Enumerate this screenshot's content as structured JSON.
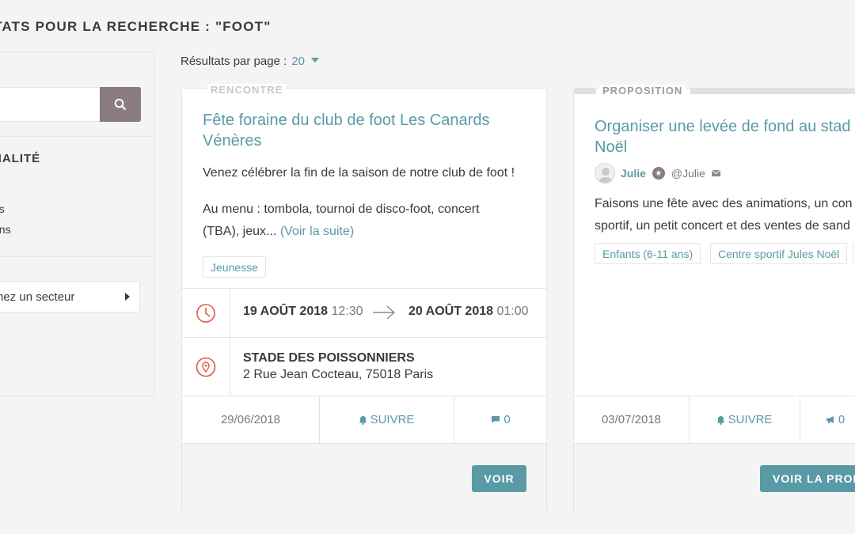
{
  "page": {
    "title": "TATS POUR LA RECHERCHE : \"FOOT\""
  },
  "sidebar": {
    "search": {
      "value": ""
    },
    "filter_title": "NALITÉ",
    "options": [
      "es",
      "ons"
    ],
    "sector_select": "nez un secteur"
  },
  "results": {
    "per_page_label": "Résultats par page :",
    "per_page_value": "20"
  },
  "cards": [
    {
      "type": "RENCONTRE",
      "title_l1": "Fête foraine du club de foot Les Canards",
      "title_l2": "Vénères",
      "text1": "Venez célébrer la fin de la saison de notre club de foot !",
      "text2_l1": "Au menu : tombola, tournoi de disco-foot, concert",
      "text2_l2": "(TBA), jeux...",
      "more": "(Voir la suite)",
      "tag": "Jeunesse",
      "start_date": "19 AOÛT 2018",
      "start_time": "12:30",
      "end_date": "20 AOÛT 2018",
      "end_time": "01:00",
      "place_name": "STADE DES POISSONNIERS",
      "place_address": "2 Rue Jean Cocteau, 75018 Paris",
      "date": "29/06/2018",
      "follow": "SUIVRE",
      "comments": "0",
      "button": "VOIR"
    },
    {
      "type": "PROPOSITION",
      "title_l1": "Organiser une levée de fond au stad",
      "title_l2": "Noël",
      "author": "Julie",
      "nickname": "@Julie",
      "text_l1": "Faisons une fête avec des animations, un con",
      "text_l2": "sportif, un petit concert et des ventes de sand",
      "tags": [
        "Enfants (6-11 ans)",
        "Centre sportif Jules Noël"
      ],
      "date": "03/07/2018",
      "follow": "SUIVRE",
      "votes": "0",
      "button": "VOIR LA PROP"
    }
  ],
  "colors": {
    "accent": "#599aa6",
    "danger_icon": "#e0584a",
    "search_button": "#8a7c82"
  }
}
